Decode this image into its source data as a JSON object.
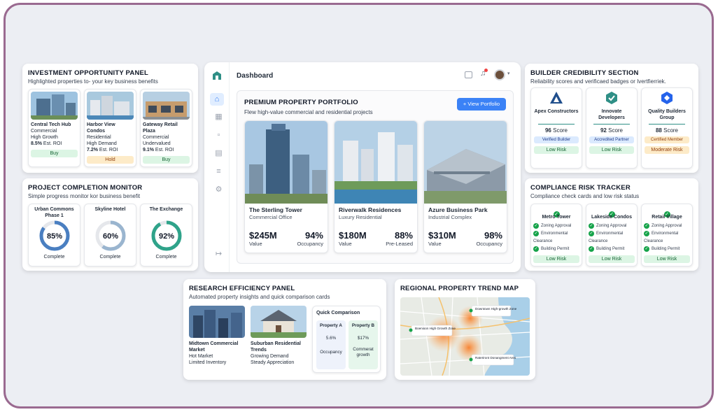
{
  "investment": {
    "title": "INVESTMENT OPPORTUNITY PANEL",
    "subtitle": "Highlighted properties to- your key business benefits",
    "cards": [
      {
        "name": "Central Tech Hub",
        "type": "Commercial",
        "note": "High Growth",
        "roi_value": "8.5%",
        "roi_label": "Est. ROI",
        "action": "Buy"
      },
      {
        "name": "Harbor View Condos",
        "type": "Residential",
        "note": "High Demand",
        "roi_value": "7.2%",
        "roi_label": "Est. ROI",
        "action": "Hold"
      },
      {
        "name": "Gateway Retail Plaza",
        "type": "Commercial",
        "note": "Undervalued",
        "roi_value": "9.1%",
        "roi_label": "Est. ROI",
        "action": "Buy"
      }
    ]
  },
  "completion": {
    "title": "PROJECT COMPLETION MONITOR",
    "subtitle": "Simple progress monitor kor business benefit",
    "items": [
      {
        "name": "Urban Commons Phase 1",
        "percent_label": "85%",
        "status": "Complete",
        "fraction": 0.85
      },
      {
        "name": "Skyline Hotel",
        "percent_label": "60%",
        "status": "Complete",
        "fraction": 0.6
      },
      {
        "name": "The Exchange",
        "percent_label": "92%",
        "status": "Complete",
        "fraction": 0.92
      }
    ]
  },
  "dashboard": {
    "header_title": "Dashboard",
    "portfolio_title": "PREMIUM PROPERTY PORTFOLIO",
    "portfolio_subtitle": "Flew high-value commercial and residential projects",
    "view_button": "View Portfolio",
    "properties": [
      {
        "name": "The Sterling Tower",
        "type": "Commercial Office",
        "value": "$245M",
        "value_label": "Value",
        "rate": "94%",
        "rate_label": "Occupancy"
      },
      {
        "name": "Riverwalk Residences",
        "type": "Luxury Residential",
        "value": "$180M",
        "value_label": "Value",
        "rate": "88%",
        "rate_label": "Pre-Leased"
      },
      {
        "name": "Azure Business Park",
        "type": "Industrial Complex",
        "value": "$310M",
        "value_label": "Value",
        "rate": "98%",
        "rate_label": "Occupancy"
      }
    ]
  },
  "builder": {
    "title": "BUILDER CREDIBILITY SECTION",
    "subtitle": "Reliability scores and verificaed badges or Ivertfierriek.",
    "items": [
      {
        "name": "Apex Constructors",
        "score": "96",
        "score_label": "Score",
        "badge": "Verified Builder",
        "risk": "Low Risk"
      },
      {
        "name": "Innovate Developers",
        "score": "92",
        "score_label": "Score",
        "badge": "Accredited Partner",
        "risk": "Low Risk"
      },
      {
        "name": "Quality Builders Group",
        "score": "88",
        "score_label": "Score",
        "badge": "Certified Member",
        "risk": "Moderate Risk"
      }
    ]
  },
  "compliance": {
    "title": "COMPLIANCE RISK TRACKER",
    "subtitle": "Compliance check cards and low risk status",
    "items": [
      {
        "name": "Metro Tower",
        "checks": [
          "Zoning Approval",
          "Environmental Clearance",
          "Building Permit"
        ],
        "risk": "Low Risk"
      },
      {
        "name": "Lakeside Condos",
        "checks": [
          "Zoning Approval",
          "Environmental Clearance",
          "Building Permit"
        ],
        "risk": "Low Risk"
      },
      {
        "name": "Retail Village",
        "checks": [
          "Zoning Approval",
          "Environmental Clearance",
          "Building Permit"
        ],
        "risk": "Low Risk"
      }
    ]
  },
  "research": {
    "title": "RESEARCH EFFICIENCY PANEL",
    "subtitle": "Automated property insights and quick comparison cards",
    "cards": [
      {
        "name": "Midtown Commercial Market",
        "line1": "Hot Market",
        "line2": "Limited Inventory"
      },
      {
        "name": "Suburban Residential Trends",
        "line1": "Growing Demand",
        "line2": "Steady Appreciation"
      }
    ],
    "comparison": {
      "title": "Quick Comparison",
      "a_label": "Property A",
      "a_value": "5.6%",
      "a_note": "Occupancy",
      "b_label": "Property B",
      "b_value": "$17%",
      "b_note": "Commerat growth"
    }
  },
  "map": {
    "title": "REGIONAL PROPERTY TREND MAP",
    "labels": [
      "Downtown High-growth Zone",
      "Boenioon High Growth Zone",
      "Rateriront Donangment Ares"
    ]
  },
  "colors": {
    "accent": "#3b82f6",
    "green": "#16a34a",
    "ring_blue": "#4a7fc1",
    "ring_teal": "#2fa38a",
    "frame": "#9a6a90"
  }
}
